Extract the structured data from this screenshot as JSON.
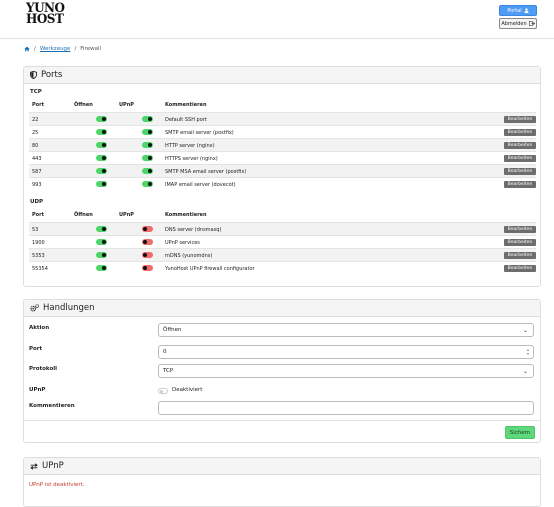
{
  "brand": {
    "line1": "YUNO",
    "line2": "HOST"
  },
  "header": {
    "portal_label": "Portal",
    "logout_label": "Abmelden"
  },
  "breadcrumb": {
    "tools": "Werkzeuge",
    "current": "Firewall"
  },
  "ports_panel": {
    "title": "Ports",
    "tcp_label": "TCP",
    "udp_label": "UDP",
    "columns": {
      "port": "Port",
      "open": "Öffnen",
      "upnp": "UPnP",
      "comment": "Kommentieren"
    },
    "edit_label": "Bearbeiten",
    "tcp_rows": [
      {
        "port": "22",
        "open": true,
        "upnp": true,
        "comment": "Default SSH port"
      },
      {
        "port": "25",
        "open": true,
        "upnp": true,
        "comment": "SMTP email server (postfix)"
      },
      {
        "port": "80",
        "open": true,
        "upnp": true,
        "comment": "HTTP server (nginx)"
      },
      {
        "port": "443",
        "open": true,
        "upnp": true,
        "comment": "HTTPS server (nginx)"
      },
      {
        "port": "587",
        "open": true,
        "upnp": true,
        "comment": "SMTP MSA email server (postfix)"
      },
      {
        "port": "993",
        "open": true,
        "upnp": true,
        "comment": "IMAP email server (dovecot)"
      }
    ],
    "udp_rows": [
      {
        "port": "53",
        "open": true,
        "upnp": false,
        "comment": "DNS server (dnsmasq)"
      },
      {
        "port": "1900",
        "open": true,
        "upnp": false,
        "comment": "UPnP services"
      },
      {
        "port": "5353",
        "open": true,
        "upnp": false,
        "comment": "mDNS (yunomdns)"
      },
      {
        "port": "55354",
        "open": true,
        "upnp": false,
        "comment": "YunoHost UPnP firewall configurator"
      }
    ]
  },
  "actions_panel": {
    "title": "Handlungen",
    "action_label": "Aktion",
    "action_value": "Öffnen",
    "port_label": "Port",
    "port_value": "0",
    "protocol_label": "Protokoll",
    "protocol_value": "TCP",
    "upnp_label": "UPnP",
    "upnp_state": "Deaktiviert",
    "comment_label": "Kommentieren",
    "comment_value": "",
    "save_label": "Sichern"
  },
  "upnp_panel": {
    "title": "UPnP",
    "status_text": "UPnP ist deaktiviert."
  },
  "colors": {
    "toggle_on": "#4cd66a",
    "toggle_off": "#f26b6b",
    "portal_button": "#4e9cf4",
    "save_button": "#5ed87a",
    "warning": "#c0392b"
  }
}
